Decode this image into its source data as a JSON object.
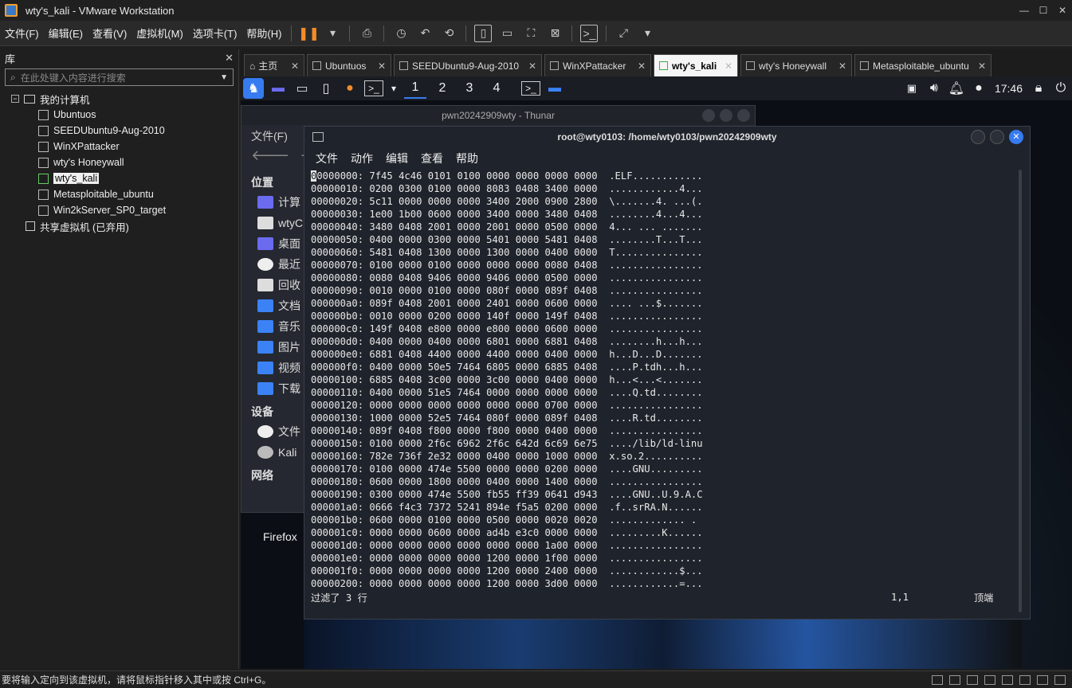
{
  "window": {
    "title": "wty's_kali - VMware Workstation"
  },
  "menu": {
    "items": [
      "文件(F)",
      "编辑(E)",
      "查看(V)",
      "虚拟机(M)",
      "选项卡(T)",
      "帮助(H)"
    ]
  },
  "library": {
    "title": "库",
    "search_placeholder": "在此处键入内容进行搜索",
    "root": "我的计算机",
    "vms": [
      "Ubuntuos",
      "SEEDUbuntu9-Aug-2010",
      "WinXPattacker",
      "wty's Honeywall",
      "wty's_kali",
      "Metasploitable_ubuntu",
      "Win2kServer_SP0_target"
    ],
    "selected_vm": "wty's_kali",
    "shared": "共享虚拟机 (已弃用)"
  },
  "tabs": [
    {
      "label": "主页"
    },
    {
      "label": "Ubuntuos"
    },
    {
      "label": "SEEDUbuntu9-Aug-2010"
    },
    {
      "label": "WinXPattacker"
    },
    {
      "label": "wty's_kali"
    },
    {
      "label": "wty's Honeywall"
    },
    {
      "label": "Metasploitable_ubuntu"
    }
  ],
  "kali_panel": {
    "workspaces": [
      "1",
      "2",
      "3",
      "4"
    ],
    "clock": "17:46"
  },
  "thunar": {
    "title": "pwn20242909wty - Thunar",
    "menu": "文件(F)",
    "section_places": "位置",
    "places": [
      "计算",
      "wtyC",
      "桌面",
      "最近",
      "回收",
      "文档",
      "音乐",
      "图片",
      "视频",
      "下载"
    ],
    "section_devices": "设备",
    "devices": [
      "文件",
      "Kali"
    ],
    "section_network": "网络"
  },
  "desktop": {
    "firefox_label": "Firefox"
  },
  "terminal": {
    "title": "root@wty0103: /home/wty0103/pwn20242909wty",
    "menu": [
      "文件",
      "动作",
      "编辑",
      "查看",
      "帮助"
    ],
    "hex_lines": [
      "00000000: 7f45 4c46 0101 0100 0000 0000 0000 0000  .ELF............",
      "00000010: 0200 0300 0100 0000 8083 0408 3400 0000  ............4...",
      "00000020: 5c11 0000 0000 0000 3400 2000 0900 2800  \\.......4. ...(.",
      "00000030: 1e00 1b00 0600 0000 3400 0000 3480 0408  ........4...4...",
      "00000040: 3480 0408 2001 0000 2001 0000 0500 0000  4... ... .......",
      "00000050: 0400 0000 0300 0000 5401 0000 5481 0408  ........T...T...",
      "00000060: 5481 0408 1300 0000 1300 0000 0400 0000  T...............",
      "00000070: 0100 0000 0100 0000 0000 0000 0080 0408  ................",
      "00000080: 0080 0408 9406 0000 9406 0000 0500 0000  ................",
      "00000090: 0010 0000 0100 0000 080f 0000 089f 0408  ................",
      "000000a0: 089f 0408 2001 0000 2401 0000 0600 0000  .... ...$.......",
      "000000b0: 0010 0000 0200 0000 140f 0000 149f 0408  ................",
      "000000c0: 149f 0408 e800 0000 e800 0000 0600 0000  ................",
      "000000d0: 0400 0000 0400 0000 6801 0000 6881 0408  ........h...h...",
      "000000e0: 6881 0408 4400 0000 4400 0000 0400 0000  h...D...D.......",
      "000000f0: 0400 0000 50e5 7464 6805 0000 6885 0408  ....P.tdh...h...",
      "00000100: 6885 0408 3c00 0000 3c00 0000 0400 0000  h...<...<.......",
      "00000110: 0400 0000 51e5 7464 0000 0000 0000 0000  ....Q.td........",
      "00000120: 0000 0000 0000 0000 0000 0000 0700 0000  ................",
      "00000130: 1000 0000 52e5 7464 080f 0000 089f 0408  ....R.td........",
      "00000140: 089f 0408 f800 0000 f800 0000 0400 0000  ................",
      "00000150: 0100 0000 2f6c 6962 2f6c 642d 6c69 6e75  ..../lib/ld-linu",
      "00000160: 782e 736f 2e32 0000 0400 0000 1000 0000  x.so.2..........",
      "00000170: 0100 0000 474e 5500 0000 0000 0200 0000  ....GNU.........",
      "00000180: 0600 0000 1800 0000 0400 0000 1400 0000  ................",
      "00000190: 0300 0000 474e 5500 fb55 ff39 0641 d943  ....GNU..U.9.A.C",
      "000001a0: 0666 f4c3 7372 5241 894e f5a5 0200 0000  .f..srRA.N......",
      "000001b0: 0600 0000 0100 0000 0500 0000 0020 0020  ............. .",
      "000001c0: 0000 0000 0600 0000 ad4b e3c0 0000 0000  .........K......",
      "000001d0: 0000 0000 0000 0000 0000 0000 1a00 0000  ................",
      "000001e0: 0000 0000 0000 0000 1200 0000 1f00 0000  ................",
      "000001f0: 0000 0000 0000 0000 1200 0000 2400 0000  ............$...",
      "00000200: 0000 0000 0000 0000 1200 0000 3d00 0000  ............=..."
    ],
    "status_left": "过滤了 3 行",
    "status_pos": "1,1",
    "status_top": "顶端"
  },
  "statusbar": {
    "message": "要将输入定向到该虚拟机，请将鼠标指针移入其中或按 Ctrl+G。"
  }
}
